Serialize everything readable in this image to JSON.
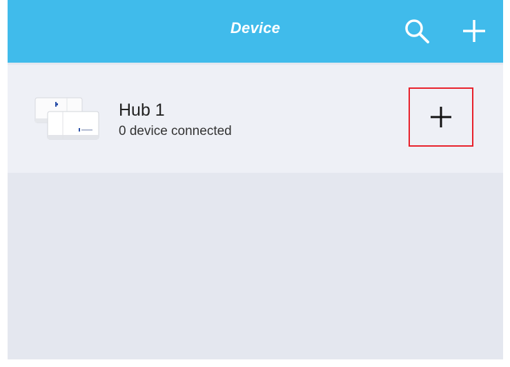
{
  "header": {
    "title": "Device",
    "search_icon": "search-icon",
    "add_icon": "plus-icon"
  },
  "devices": [
    {
      "name": "Hub 1",
      "status": "0 device connected",
      "image_icon": "hub-device-image",
      "add_icon": "plus-icon"
    }
  ],
  "colors": {
    "header_bg": "#40bbeb",
    "row_bg": "#eef0f6",
    "list_bg": "#e4e7ef",
    "highlight_border": "#e8202a"
  }
}
